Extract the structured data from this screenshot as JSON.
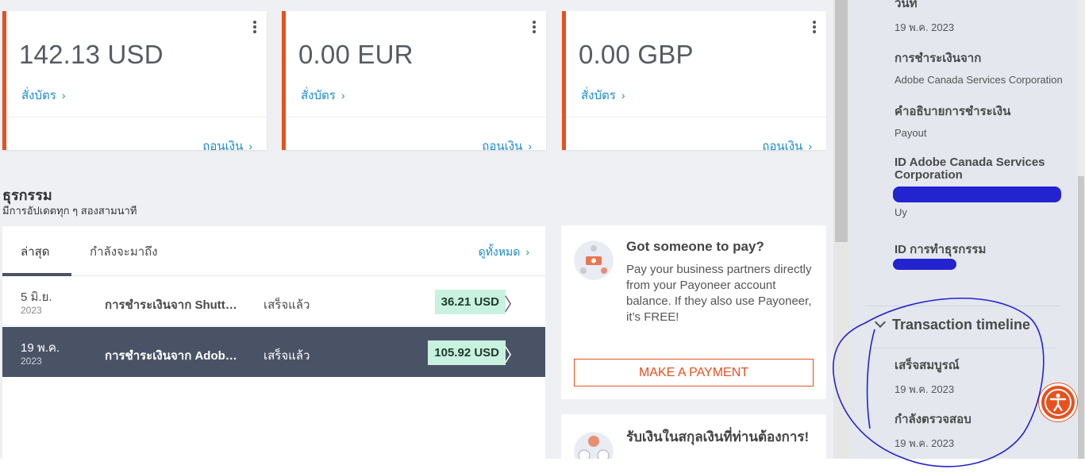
{
  "balances": [
    {
      "amount": "142.13 USD",
      "order_card": "สั่งบัตร",
      "withdraw": "ถอนเงิน"
    },
    {
      "amount": "0.00 EUR",
      "order_card": "สั่งบัตร",
      "withdraw": "ถอนเงิน"
    },
    {
      "amount": "0.00 GBP",
      "order_card": "สั่งบัตร",
      "withdraw": "ถอนเงิน"
    }
  ],
  "transactions": {
    "title": "ธุรกรรม",
    "subtitle": "มีการอัปเดตทุก ๆ สองสามนาที",
    "tabs": [
      {
        "label": "ล่าสุด"
      },
      {
        "label": "กำลังจะมาถึง"
      }
    ],
    "view_all": "ดูทั้งหมด",
    "rows": [
      {
        "date": "5 มิ.ย.",
        "year": "2023",
        "description": "การชำระเงินจาก Shutterstock",
        "status": "เสร็จแล้ว",
        "amount": "36.21 USD"
      },
      {
        "date": "19 พ.ค.",
        "year": "2023",
        "description": "การชำระเงินจาก Adobe Canada Services Corporation",
        "status": "เสร็จแล้ว",
        "amount": "105.92 USD"
      }
    ]
  },
  "promo_pay": {
    "title": "Got someone to pay?",
    "text": "Pay your business partners directly from your Payoneer account balance. If they also use Payoneer, it’s FREE!",
    "button": "MAKE A PAYMENT"
  },
  "promo_currency": {
    "title": "รับเงินในสกุลเงินที่ท่านต้องการ!"
  },
  "details": {
    "date_label": "วันที่",
    "date_value": "19 พ.ค. 2023",
    "payment_from_label": "การชำระเงินจาก",
    "payment_from_value": "Adobe Canada Services Corporation",
    "payment_desc_label": "คำอธิบายการชำระเงิน",
    "payment_desc_value": "Payout",
    "payer_id_label": "ID Adobe Canada Services Corporation",
    "payer_id_suffix": "Uy",
    "transaction_id_label": "ID การทำธุรกรรม"
  },
  "timeline": {
    "title": "Transaction timeline",
    "steps": [
      {
        "label": "เสร็จสมบูรณ์",
        "date": "19 พ.ค. 2023"
      },
      {
        "label": "กำลังตรวจสอบ",
        "date": "19 พ.ค. 2023"
      }
    ]
  },
  "colors": {
    "accent": "#e8501e",
    "link": "#1b8bd0",
    "selected_row": "#4a5366",
    "amount_badge": "#c9f1df",
    "annotation_ink": "#2323d0"
  },
  "icons": {
    "kebab": "more-vertical-icon",
    "chevron": "chevron-right-icon",
    "accessibility": "accessibility-icon"
  }
}
